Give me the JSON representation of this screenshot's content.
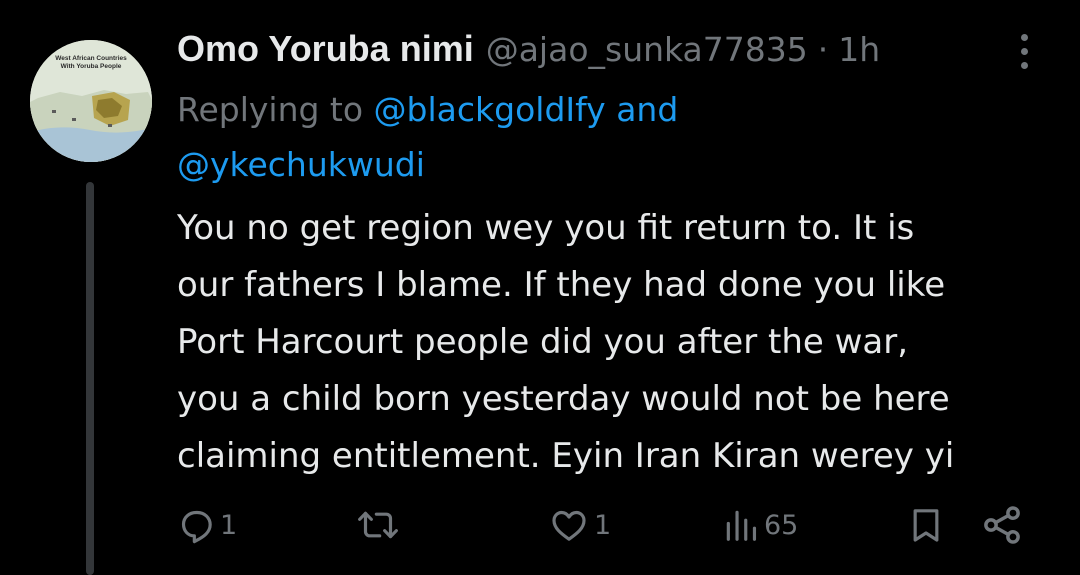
{
  "tweet": {
    "display_name": "Omo Yoruba nimi",
    "handle": "@ajao_sunka77835",
    "separator": "·",
    "time": "1h",
    "replying_prefix": "Replying to",
    "mention_1": "@blackgoldIfy",
    "mention_joiner": "and",
    "mention_2": "@ykechukwudi",
    "body_lines": [
      "You no get region wey you fit return to. It is",
      "our fathers I blame. If they had done you like",
      "Port Harcourt people did you after the war,",
      "you a child born yesterday would not be here",
      "claiming entitlement. Eyin Iran Kiran werey yi"
    ]
  },
  "avatar": {
    "caption_line_1": "West African Countries",
    "caption_line_2": "With Yoruba People"
  },
  "actions": {
    "reply_count": "1",
    "retweet_count": "",
    "like_count": "1",
    "views_count": "65"
  },
  "icons": {
    "reply": "reply-icon",
    "retweet": "retweet-icon",
    "like": "like-icon",
    "views": "views-icon",
    "bookmark": "bookmark-icon",
    "share": "share-icon",
    "more": "more-icon"
  },
  "colors": {
    "background": "#000000",
    "text_primary": "#e7e9ea",
    "text_secondary": "#71767b",
    "link": "#1d9bf0",
    "thread_line": "#333639"
  }
}
